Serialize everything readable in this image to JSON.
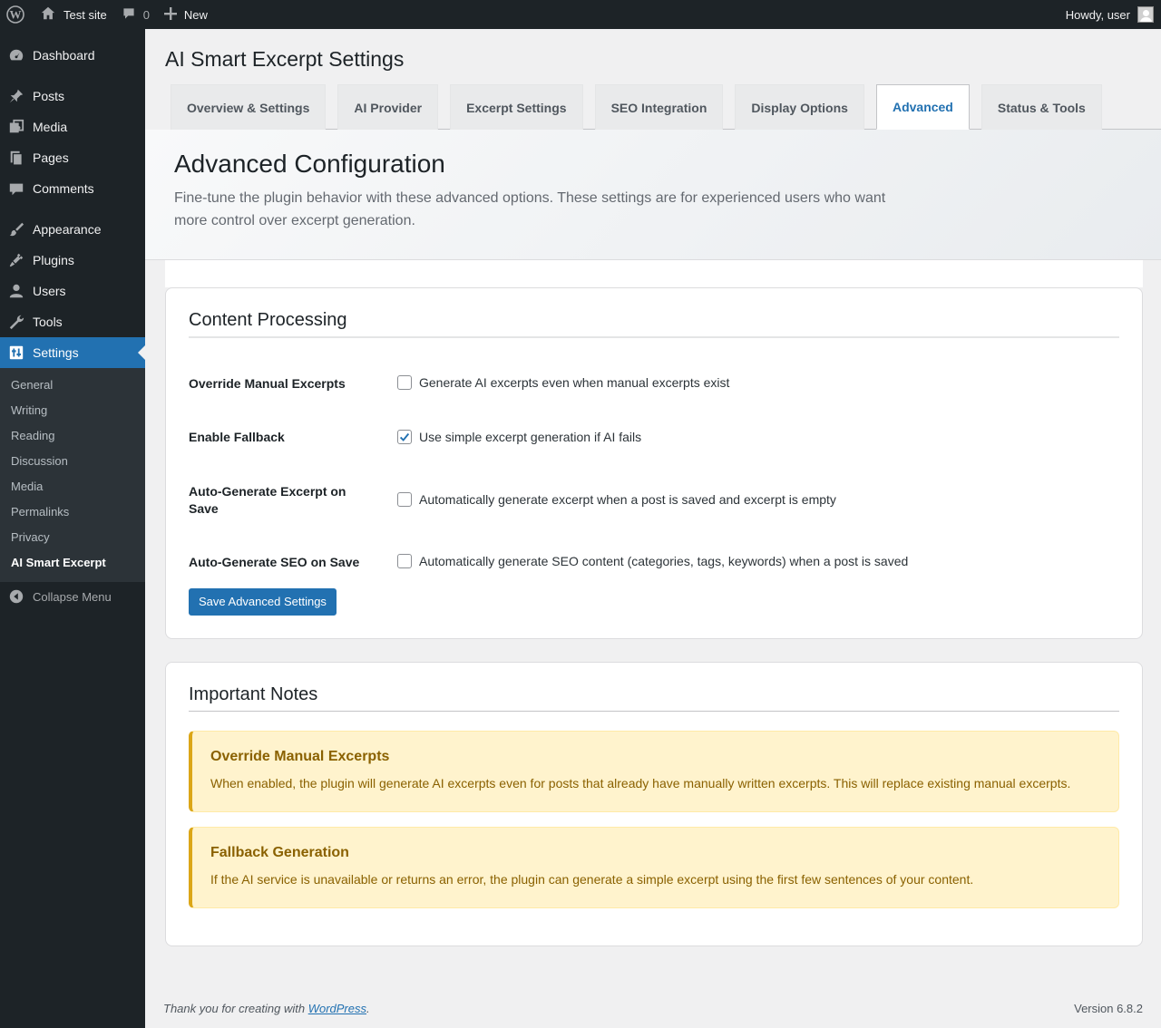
{
  "admin_bar": {
    "site_name": "Test site",
    "comments_count": "0",
    "new_label": "New",
    "greeting": "Howdy, user"
  },
  "menu": {
    "items": [
      {
        "label": "Dashboard",
        "icon": "dashboard-icon"
      },
      {
        "label": "Posts",
        "icon": "pin-icon"
      },
      {
        "label": "Media",
        "icon": "media-icon"
      },
      {
        "label": "Pages",
        "icon": "pages-icon"
      },
      {
        "label": "Comments",
        "icon": "comment-icon"
      },
      {
        "label": "Appearance",
        "icon": "brush-icon"
      },
      {
        "label": "Plugins",
        "icon": "plug-icon"
      },
      {
        "label": "Users",
        "icon": "user-icon"
      },
      {
        "label": "Tools",
        "icon": "wrench-icon"
      },
      {
        "label": "Settings",
        "icon": "settings-icon"
      }
    ],
    "submenu": [
      "General",
      "Writing",
      "Reading",
      "Discussion",
      "Media",
      "Permalinks",
      "Privacy",
      "AI Smart Excerpt"
    ],
    "collapse_label": "Collapse Menu"
  },
  "page": {
    "title": "AI Smart Excerpt Settings",
    "tabs": [
      "Overview & Settings",
      "AI Provider",
      "Excerpt Settings",
      "SEO Integration",
      "Display Options",
      "Advanced",
      "Status & Tools"
    ],
    "active_tab": "Advanced"
  },
  "hero": {
    "title": "Advanced Configuration",
    "description": "Fine-tune the plugin behavior with these advanced options. These settings are for experienced users who want more control over excerpt generation."
  },
  "content_processing": {
    "title": "Content Processing",
    "rows": [
      {
        "label": "Override Manual Excerpts",
        "description": "Generate AI excerpts even when manual excerpts exist",
        "checked": false
      },
      {
        "label": "Enable Fallback",
        "description": "Use simple excerpt generation if AI fails",
        "checked": true
      },
      {
        "label": "Auto-Generate Excerpt on Save",
        "description": "Automatically generate excerpt when a post is saved and excerpt is empty",
        "checked": false
      },
      {
        "label": "Auto-Generate SEO on Save",
        "description": "Automatically generate SEO content (categories, tags, keywords) when a post is saved",
        "checked": false
      }
    ],
    "save_label": "Save Advanced Settings"
  },
  "notes": {
    "title": "Important Notes",
    "items": [
      {
        "title": "Override Manual Excerpts",
        "text": "When enabled, the plugin will generate AI excerpts even for posts that already have manually written excerpts. This will replace existing manual excerpts."
      },
      {
        "title": "Fallback Generation",
        "text": "If the AI service is unavailable or returns an error, the plugin can generate a simple excerpt using the first few sentences of your content."
      }
    ]
  },
  "footer": {
    "thanks_prefix": "Thank you for creating with ",
    "link_text": "WordPress",
    "thanks_suffix": ".",
    "version": "Version 6.8.2"
  },
  "colors": {
    "accent": "#2271b1",
    "admin_bg": "#1d2327",
    "notice_bg": "#fff3cd",
    "notice_border": "#dba617"
  }
}
